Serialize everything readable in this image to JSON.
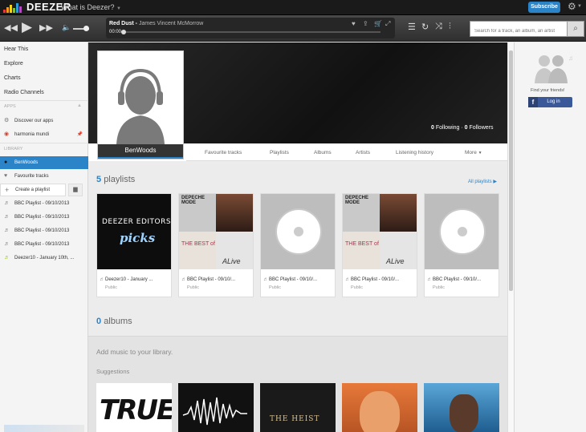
{
  "topbar": {
    "logo": "DEEZER",
    "what_is": "What is Deezer?",
    "subscribe": "Subscribe"
  },
  "player": {
    "track_title": "Red Dust",
    "track_artist": "James Vincent McMorrow",
    "time": "00:00",
    "progress": 0.0,
    "volume": 0.8,
    "search_placeholder": "Search for a track, an album, an artist"
  },
  "sidebar": {
    "nav": [
      "Hear This",
      "Explore",
      "Charts",
      "Radio Channels"
    ],
    "apps_section": "APPS",
    "apps": [
      "Discover our apps",
      "harmonia mundi"
    ],
    "library_section": "LIBRARY",
    "library_user": "BenWoods",
    "favourite": "Favourite tracks",
    "create": "Create a playlist",
    "playlists": [
      "BBC Playlist - 09/10/2013",
      "BBC Playlist - 09/10/2013",
      "BBC Playlist - 09/10/2013",
      "BBC Playlist - 09/10/2013",
      "Deezer10 - January 10th, ..."
    ]
  },
  "profile": {
    "name": "BenWoods",
    "following_count": "0",
    "following_label": "Following",
    "followers_count": "0",
    "followers_label": "Followers",
    "tabs": [
      "Favourite tracks",
      "Playlists",
      "Albums",
      "Artists",
      "Listening history",
      "More"
    ]
  },
  "playlists_section": {
    "count": "5",
    "label": "playlists",
    "all_link": "All playlists",
    "cards": [
      {
        "title": "Deezer10 - January ...",
        "sub": "Public",
        "cover": "editors"
      },
      {
        "title": "BBC Playlist - 09/10/...",
        "sub": "Public",
        "cover": "mosaic"
      },
      {
        "title": "BBC Playlist - 09/10/...",
        "sub": "Public",
        "cover": "disc"
      },
      {
        "title": "BBC Playlist - 09/10/...",
        "sub": "Public",
        "cover": "mosaic"
      },
      {
        "title": "BBC Playlist - 09/10/...",
        "sub": "Public",
        "cover": "disc"
      }
    ],
    "editors_cover_line1": "DEEZER EDITORS'",
    "editors_cover_line2": "picks",
    "mosaic_tl": "DEPECHE MODE",
    "mosaic_bl": "THE BEST of",
    "mosaic_br": "ALive"
  },
  "albums_section": {
    "count": "0",
    "label": "albums",
    "add_music": "Add music to your library.",
    "suggestions": "Suggestions",
    "sugg_cover_1": "TRUE",
    "sugg_cover_3": "THE HEIST"
  },
  "rightbar": {
    "find_friends": "Find your friends!",
    "login": "Log in"
  },
  "colors": {
    "accent": "#2b83c8",
    "facebook": "#3b5998"
  }
}
